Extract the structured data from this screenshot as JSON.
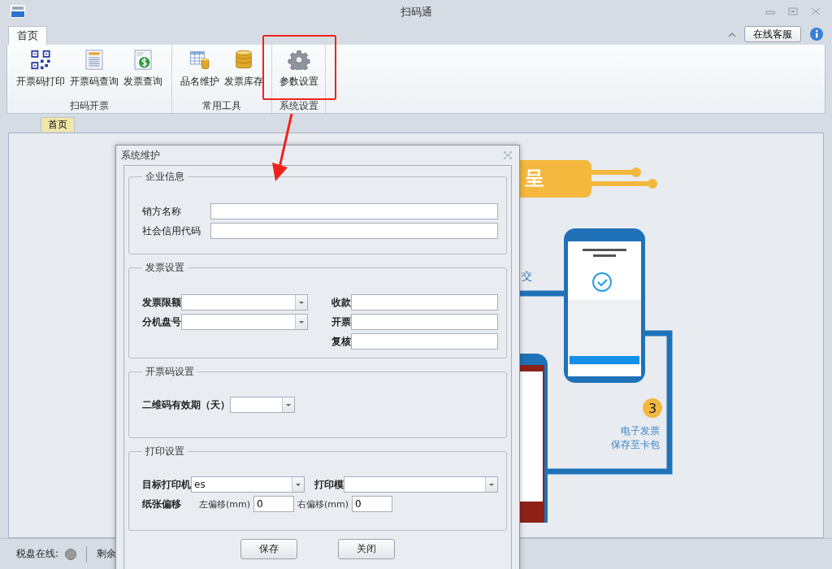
{
  "window": {
    "title": "扫码通",
    "help_button": "在线客服"
  },
  "tabs": [
    {
      "label": "首页",
      "selected": true
    }
  ],
  "ribbon": {
    "groups": [
      {
        "label": "扫码开票",
        "buttons": [
          {
            "label": "开票码打印",
            "kind": "qr"
          },
          {
            "label": "开票码查询",
            "kind": "doc"
          },
          {
            "label": "发票查询",
            "kind": "dollar"
          }
        ]
      },
      {
        "label": "常用工具",
        "buttons": [
          {
            "label": "品名维护",
            "kind": "table"
          },
          {
            "label": "发票库存",
            "kind": "db"
          }
        ]
      },
      {
        "label": "系统设置",
        "buttons": [
          {
            "label": "参数设置",
            "kind": "gear"
          }
        ]
      }
    ]
  },
  "document_tabs": [
    {
      "label": "首页",
      "selected": true
    }
  ],
  "illustration": {
    "banner_text": "呈",
    "side_text": "交",
    "step_number": "3",
    "step_caption": [
      "电子发票",
      "保存至卡包"
    ]
  },
  "dialog": {
    "title": "系统维护",
    "sections": [
      {
        "title": "企业信息",
        "fields": [
          {
            "label": "销方名称",
            "kind": "text",
            "bold": false
          },
          {
            "label": "社会信用代码",
            "kind": "text",
            "bold": false
          }
        ]
      },
      {
        "title": "发票设置",
        "fields": [
          {
            "label": "发票限额",
            "kind": "combo",
            "bold": true
          },
          {
            "label": "收款",
            "kind": "text",
            "bold": true
          },
          {
            "label": "分机盘号",
            "kind": "combo",
            "bold": true
          },
          {
            "label": "开票",
            "kind": "text",
            "bold": true
          },
          {
            "label": "复核",
            "kind": "text",
            "bold": true
          }
        ]
      },
      {
        "title": "开票码设置",
        "fields": [
          {
            "label": "二维码有效期（天）",
            "kind": "combo",
            "bold": true
          }
        ]
      },
      {
        "title": "打印设置",
        "fields": [
          {
            "label": "目标打印机",
            "kind": "combo",
            "bold": true,
            "value": "es"
          },
          {
            "label": "打印模",
            "kind": "combo",
            "bold": true
          },
          {
            "label": "纸张偏移",
            "kind": "offset",
            "bold": true,
            "parts": [
              {
                "label": "左偏移(mm)",
                "value": "0"
              },
              {
                "label": "右偏移(mm)",
                "value": "0"
              }
            ]
          }
        ]
      }
    ]
  },
  "buttons": [
    "保存",
    "关闭"
  ],
  "status_bar": {
    "label": "税盘在线:",
    "online": false,
    "remaining": "剩余"
  }
}
